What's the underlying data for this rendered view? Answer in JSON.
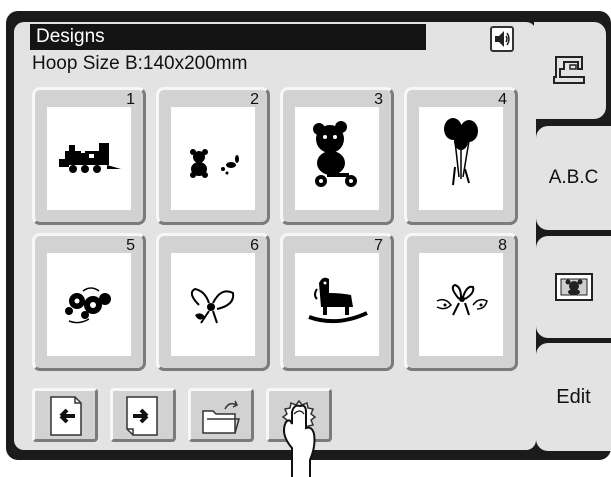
{
  "header": {
    "title": "Designs",
    "hoop_size": "Hoop Size B:140x200mm"
  },
  "designs": [
    {
      "number": "1",
      "name": "locomotive"
    },
    {
      "number": "2",
      "name": "bear-and-bunny"
    },
    {
      "number": "3",
      "name": "bear-on-scooter"
    },
    {
      "number": "4",
      "name": "balloons"
    },
    {
      "number": "5",
      "name": "flowers"
    },
    {
      "number": "6",
      "name": "bow-flower"
    },
    {
      "number": "7",
      "name": "rocking-horse"
    },
    {
      "number": "8",
      "name": "ribbon-bow"
    }
  ],
  "toolbar": {
    "icons": [
      "page-previous-icon",
      "page-next-icon",
      "open-folder-icon",
      "settings-gear-icon"
    ]
  },
  "tabs": {
    "abc": "A.B.C",
    "edit": "Edit"
  },
  "colors": {
    "panel": "#e3e3e3",
    "bezel": "#1b1b1b",
    "title_bar": "#141414",
    "button": "#d2d2d2"
  }
}
